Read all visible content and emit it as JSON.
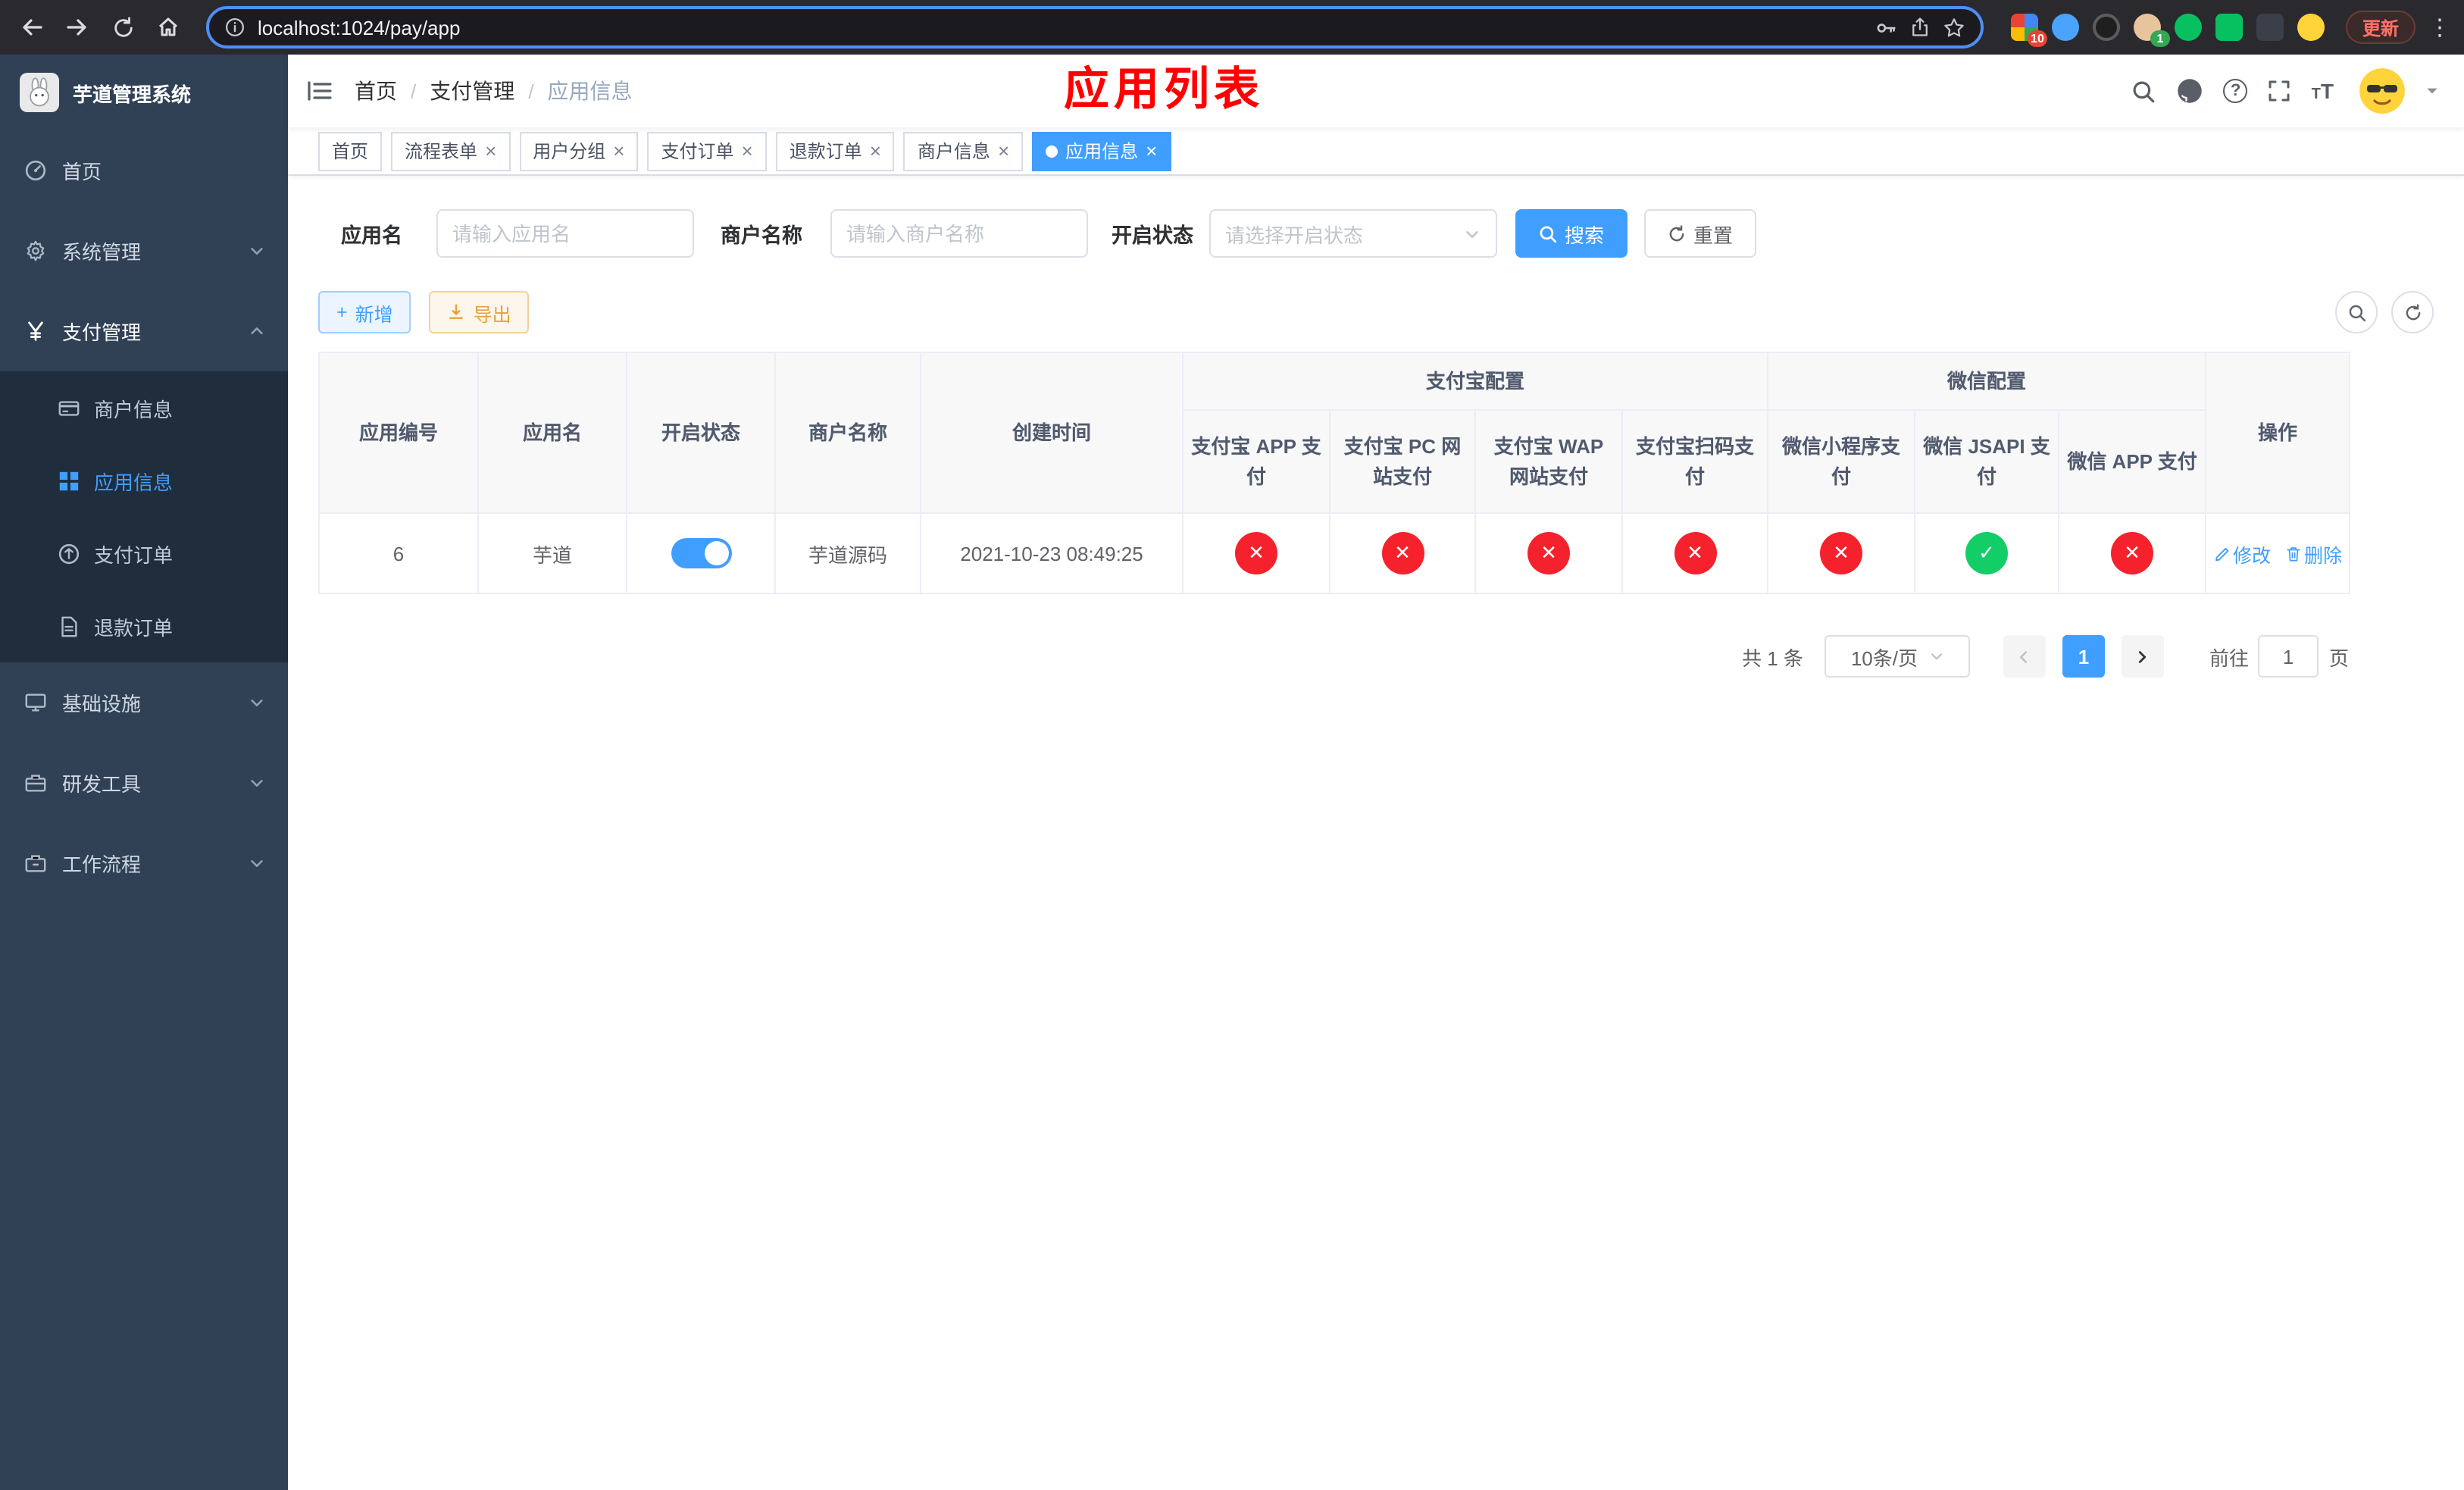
{
  "browser": {
    "url": "localhost:1024/pay/app",
    "update_label": "更新",
    "extension_badge_red": "10",
    "extension_badge_green": "1"
  },
  "sidebar": {
    "title": "芋道管理系统",
    "items": {
      "home": "首页",
      "system": "系统管理",
      "payment": "支付管理",
      "infra": "基础设施",
      "devtools": "研发工具",
      "workflow": "工作流程"
    },
    "payment_children": {
      "merchant": "商户信息",
      "app": "应用信息",
      "pay_order": "支付订单",
      "refund_order": "退款订单"
    }
  },
  "navbar": {
    "breadcrumb": {
      "home": "首页",
      "section": "支付管理",
      "page": "应用信息"
    },
    "annotation": "应用列表"
  },
  "tabs": [
    {
      "label": "首页"
    },
    {
      "label": "流程表单"
    },
    {
      "label": "用户分组"
    },
    {
      "label": "支付订单"
    },
    {
      "label": "退款订单"
    },
    {
      "label": "商户信息"
    },
    {
      "label": "应用信息"
    }
  ],
  "filters": {
    "app_name_label": "应用名",
    "app_name_placeholder": "请输入应用名",
    "merchant_label": "商户名称",
    "merchant_placeholder": "请输入商户名称",
    "status_label": "开启状态",
    "status_placeholder": "请选择开启状态",
    "search_label": "搜索",
    "reset_label": "重置"
  },
  "toolbar": {
    "add_label": "新增",
    "export_label": "导出"
  },
  "table": {
    "groups": {
      "alipay": "支付宝配置",
      "wechat": "微信配置"
    },
    "columns": {
      "app_id": "应用编号",
      "app_name": "应用名",
      "status": "开启状态",
      "merchant": "商户名称",
      "created_at": "创建时间",
      "alipay_app": "支付宝 APP 支付",
      "alipay_pc": "支付宝 PC 网站支付",
      "alipay_wap": "支付宝 WAP 网站支付",
      "alipay_qr": "支付宝扫码支付",
      "wechat_mini": "微信小程序支付",
      "wechat_jsapi": "微信 JSAPI 支付",
      "wechat_app": "微信 APP 支付",
      "actions": "操作"
    },
    "rows": [
      {
        "app_id": "6",
        "app_name": "芋道",
        "status_enabled": true,
        "merchant": "芋道源码",
        "created_at": "2021-10-23 08:49:25",
        "config_states": [
          "no",
          "no",
          "no",
          "no",
          "no",
          "yes",
          "no"
        ],
        "edit_label": "修改",
        "delete_label": "删除"
      }
    ]
  },
  "pagination": {
    "total_text": "共 1 条",
    "page_size": "10条/页",
    "current_page": "1",
    "goto_label": "前往",
    "goto_value": "1",
    "page_unit": "页"
  },
  "colors": {
    "primary": "#409EFF",
    "annotation": "#FF0000",
    "danger": "#F5222D",
    "success": "#13CE66",
    "sidebar_bg": "#304156",
    "submenu_bg": "#1F2D3D"
  }
}
